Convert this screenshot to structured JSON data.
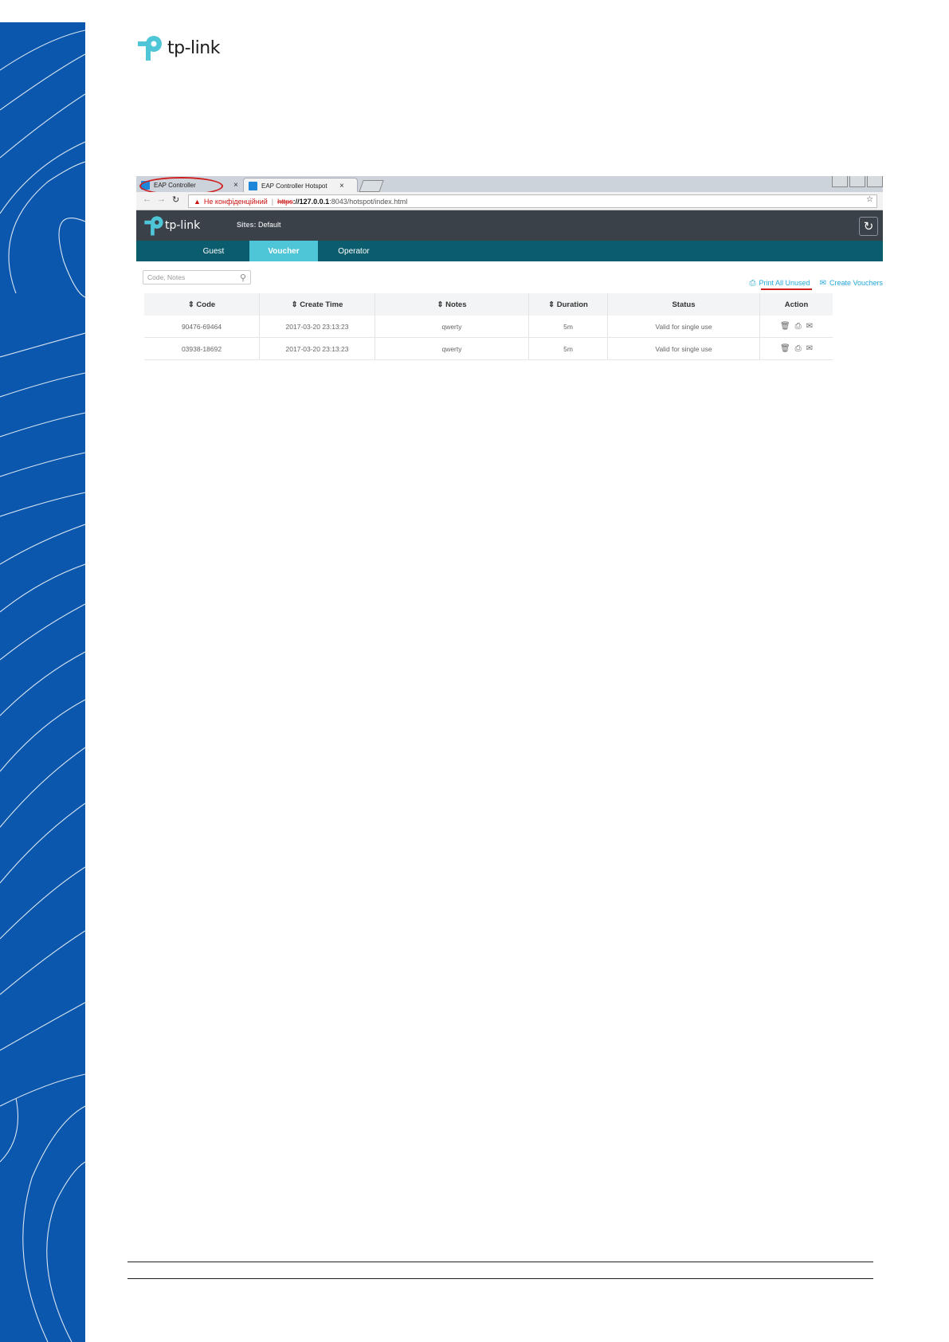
{
  "document": {
    "brand_name": "tp-link"
  },
  "screenshot": {
    "browser": {
      "tabs": [
        {
          "label": "EAP Controller"
        },
        {
          "label": "EAP Controller Hotspot"
        }
      ],
      "close_glyph": "×",
      "address": {
        "warning": "Не конфіденційний",
        "scheme": "https",
        "host": "://127.0.0.1",
        "path": ":8043/hotspot/index.html"
      }
    },
    "app": {
      "brand": "tp-link",
      "sites_label": "Sites:",
      "sites_value": "Default",
      "nav": [
        "Guest",
        "Voucher",
        "Operator"
      ],
      "active_nav": "Voucher"
    },
    "search": {
      "placeholder": "Code, Notes"
    },
    "actions": {
      "print_all_unused": "Print All Unused",
      "create_vouchers": "Create Vouchers"
    },
    "table": {
      "columns": [
        "Code",
        "Create Time",
        "Notes",
        "Duration",
        "Status",
        "Action"
      ],
      "sortable_marker": "⇕",
      "rows": [
        {
          "code": "90476-69464",
          "create_time": "2017-03-20 23:13:23",
          "notes": "qwerty",
          "duration": "5m",
          "status": "Valid for single use"
        },
        {
          "code": "03938-18692",
          "create_time": "2017-03-20 23:13:23",
          "notes": "qwerty",
          "duration": "5m",
          "status": "Valid for single use"
        }
      ]
    },
    "icons": [
      "warning-icon",
      "search-icon",
      "refresh-icon",
      "print-icon",
      "voucher-icon",
      "delete-icon"
    ],
    "colors": {
      "header": "#3a4149",
      "nav": "#0b5c6c",
      "active_tab": "#4fc6d8",
      "link": "#23a9d9",
      "highlight": "#d01d1d",
      "side_band": "#0a57ad"
    }
  }
}
